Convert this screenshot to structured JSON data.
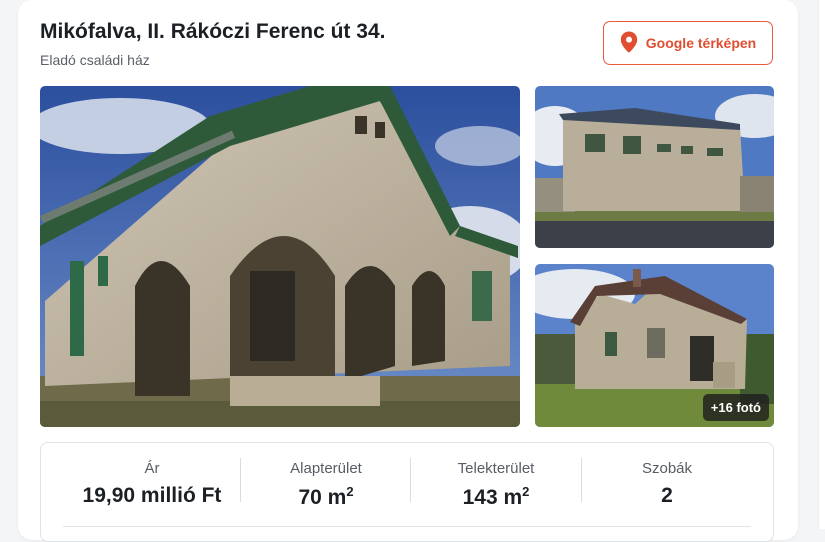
{
  "listing": {
    "title": "Mikófalva, II. Rákóczi Ferenc út 34.",
    "subtitle": "Eladó családi ház"
  },
  "map_button": {
    "label": "Google térképen",
    "icon": "map-pin-icon",
    "color": "#e04e31"
  },
  "gallery": {
    "more_photos_label": "+16 fotó"
  },
  "stats": [
    {
      "label": "Ár",
      "value": "19,90 millió Ft",
      "unit": ""
    },
    {
      "label": "Alapterület",
      "value": "70 m",
      "unit": "2"
    },
    {
      "label": "Telekterület",
      "value": "143 m",
      "unit": "2"
    },
    {
      "label": "Szobák",
      "value": "2",
      "unit": ""
    }
  ]
}
